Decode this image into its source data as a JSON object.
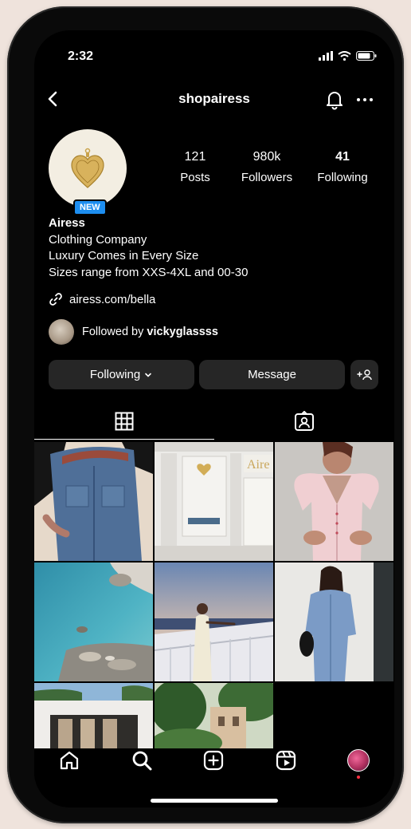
{
  "status": {
    "time": "2:32"
  },
  "header": {
    "username": "shopairess"
  },
  "profile": {
    "badge": "NEW",
    "name": "Airess",
    "bio": [
      "Clothing Company",
      "Luxury Comes in Every Size",
      "Sizes range from XXS-4XL and 00-30"
    ],
    "link": "airess.com/bella",
    "followed_by_prefix": "Followed by ",
    "followed_by_user": "vickyglassss"
  },
  "stats": [
    {
      "value": "121",
      "label": "Posts"
    },
    {
      "value": "980k",
      "label": "Followers"
    },
    {
      "value": "41",
      "label": "Following"
    }
  ],
  "actions": {
    "following": "Following",
    "message": "Message",
    "add_person": "+☺"
  },
  "icons": {
    "back": "back-chevron-icon",
    "notifications": "bell-icon",
    "more": "more-icon",
    "grid_tab": "grid-icon",
    "tagged_tab": "tagged-icon",
    "nav": [
      "home-icon",
      "search-icon",
      "create-icon",
      "reels-icon",
      "profile-avatar"
    ]
  },
  "grid_labels": {
    "storefront_sign": "Aire"
  },
  "colors": {
    "background": "#000000",
    "button": "#262626",
    "badge": "#1d8ef0",
    "text": "#ffffff"
  }
}
